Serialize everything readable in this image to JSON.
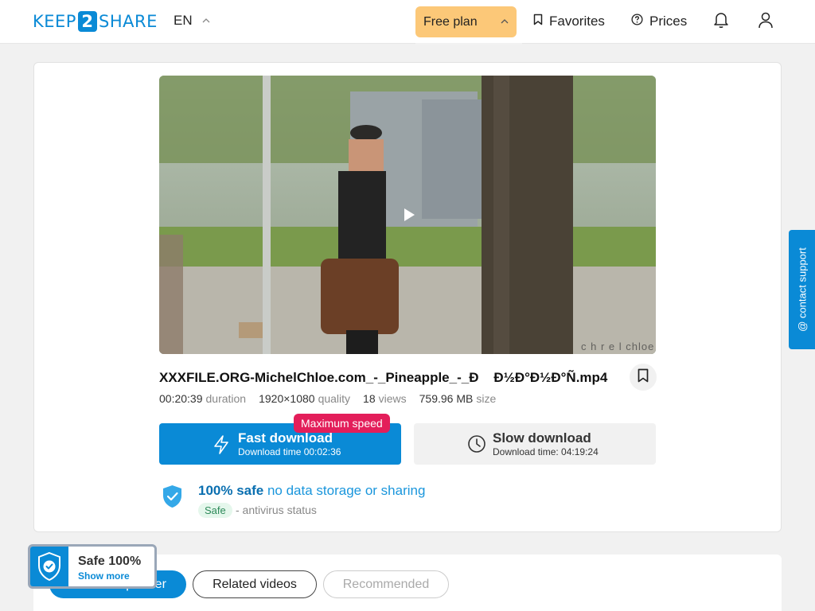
{
  "header": {
    "logo": {
      "left": "KEEP",
      "mid": "2",
      "right": "SHARE"
    },
    "language": "EN",
    "plan": "Free plan",
    "favorites": "Favorites",
    "prices": "Prices"
  },
  "video": {
    "watermark": "c h r e l chloe"
  },
  "file": {
    "name": "XXXFILE.ORG-MichelChloe.com_-_Pineapple_-_Ð    Ð½Ð°Ð½Ð°Ñ.mp4",
    "duration": "00:20:39",
    "duration_label": "duration",
    "quality": "1920×1080",
    "quality_label": "quality",
    "views": "18",
    "views_label": "views",
    "size": "759.96 MB",
    "size_label": "size"
  },
  "download": {
    "fast_title": "Fast download",
    "fast_time": "Download time 00:02:36",
    "max_speed": "Maximum speed",
    "slow_title": "Slow download",
    "slow_time": "Download time: 04:19:24"
  },
  "safety": {
    "bold": "100% safe",
    "text": "no data storage or sharing",
    "badge": "Safe",
    "status": "- antivirus status"
  },
  "support": "@ contact support",
  "tabs": [
    "From this partner",
    "Related videos",
    "Recommended"
  ],
  "safe_widget": {
    "title": "Safe 100%",
    "link": "Show more"
  },
  "colors": {
    "brand": "#0a8ad6",
    "plan": "#fcc878",
    "max_speed": "#e31e5a"
  }
}
